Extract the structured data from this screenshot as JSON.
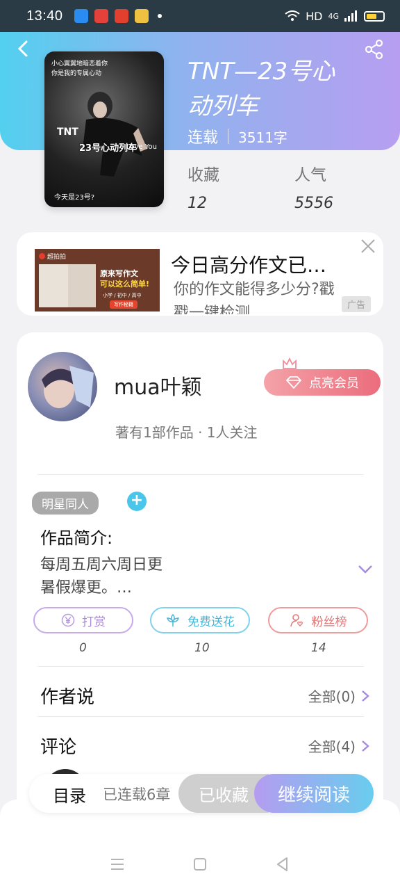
{
  "status_bar": {
    "time": "13:40",
    "network": "HD",
    "signal": "4G"
  },
  "book": {
    "title": "TNT—23号心动列车",
    "status": "连载",
    "word_count": "3511字",
    "cover": {
      "top_text_1": "小心翼翼地暗恋着你",
      "top_text_2": "你是我的专属心动",
      "group": "TNT",
      "title": "23号心动列车",
      "love": "Love You",
      "bottom": "今天是23号?"
    },
    "stats": [
      {
        "label": "收藏",
        "value": "12"
      },
      {
        "label": "人气",
        "value": "5556"
      }
    ]
  },
  "ad": {
    "title": "今日高分作文已…",
    "description": "你的作文能得多少分?戳戳一键检测",
    "badge": "广告",
    "image": {
      "brand": "超拍拍",
      "headline_1": "原来写作文",
      "headline_2": "可以这么简单!",
      "levels": "小学 / 初中 / 高中",
      "cta": "写作秘籍"
    }
  },
  "author": {
    "name": "mua叶颖",
    "vip_label": "点亮会员",
    "stats": "著有1部作品 · 1人关注"
  },
  "tag": {
    "label": "明星同人",
    "add": "+"
  },
  "intro": {
    "label": "作品简介:",
    "line1": "每周五周六周日更",
    "line2": "暑假爆更。…"
  },
  "actions": [
    {
      "label": "打赏",
      "count": "0",
      "icon": "yen-icon"
    },
    {
      "label": "免费送花",
      "count": "10",
      "icon": "flower-icon"
    },
    {
      "label": "粉丝榜",
      "count": "14",
      "icon": "fans-icon"
    }
  ],
  "sections": {
    "author_say": {
      "title": "作者说",
      "more": "全部(0)"
    },
    "comments": {
      "title": "评论",
      "more": "全部(4)"
    }
  },
  "bottom_bar": {
    "catalog": "目录",
    "chapters": "已连载6章",
    "collected": "已收藏",
    "read": "继续阅读"
  },
  "colors": {
    "accent_purple": "#b59cf0",
    "accent_blue": "#53d0ef",
    "vip_pink": "#eb6d7c"
  }
}
